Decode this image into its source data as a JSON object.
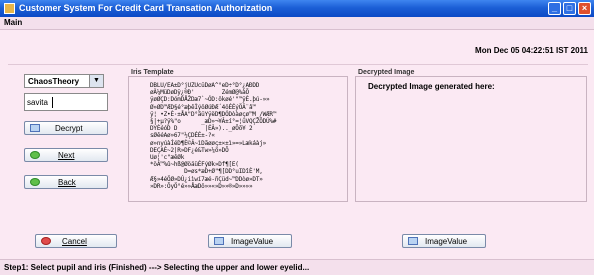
{
  "window": {
    "title": "Customer System For Credit Card Transation Authorization"
  },
  "menu": {
    "main_label": "Main"
  },
  "header": {
    "datetime": "Mon Dec 05 04:22:51 IST 2011"
  },
  "left": {
    "algorithm_select": "ChaosTheory",
    "name_value": "savita",
    "decrypt_label": "Decrypt",
    "next_label": "Next",
    "back_label": "Back"
  },
  "iris_panel": {
    "title": "Iris Template",
    "text": "DBLÛ/ÉA±D°jÜŽUcüDøÃ^°eD÷°D°¿AÐDD\nøÄ¼MüDøDÿ¿®Ð'        ZémØ@%àÕ\nÿøØÇD:DómDÅŽDæ7`~ÓD:ökøé'\"™ÿÈ.þú-»»\nØ»ØD™ÆD§é°æþêÌýöØúÐÆ´4öÉÉýÖÂ¨â™\nÿ¦ •Z•È·±ÅA\"D°ãüYÿëD¶DÓDòàøçø™M_/WÆR™\n§|+µ?ÿ%\"o      _æD»¬¥Â±í°=¦üVQÇŽÕDÚ%#\nDÝÈéóD D        |ÉÂ»).._øÕõ¥ 2\nsØêéAø»67\"½ÇDÉÉ±-?«\nø»nyúàÍéD¶È©Â~ìDãøøç±×±ì»=»Lækáàj»\nDEÇAÈ~2|R»DF¿é&Tw»¼ö»DÕ\nUø¦'c\"æêØk\n*öÂ™%û~hß@ØöäüÉFýØk»Df¶[E(\n          D=øs*æD+Ø\"¶[DD°uIDîÈ'M,\nÆ§»4éÖØ»DÚ¿iìwí7æé-ñÇüd~™DDòø»DT»\n»DR»:ÕyÖ°é»»ÅæDö»»«»D»»®»D»»»»"
  },
  "decrypted_panel": {
    "title": "Decrypted Image",
    "message": "Decrypted Image generated here:"
  },
  "bottom": {
    "cancel_label": "Cancel",
    "image_value_1": "ImageValue",
    "image_value_2": "ImageValue"
  },
  "status": {
    "text": "Step1: Select pupil and iris (Finished) ---> Selecting the upper and lower eyelid..."
  }
}
